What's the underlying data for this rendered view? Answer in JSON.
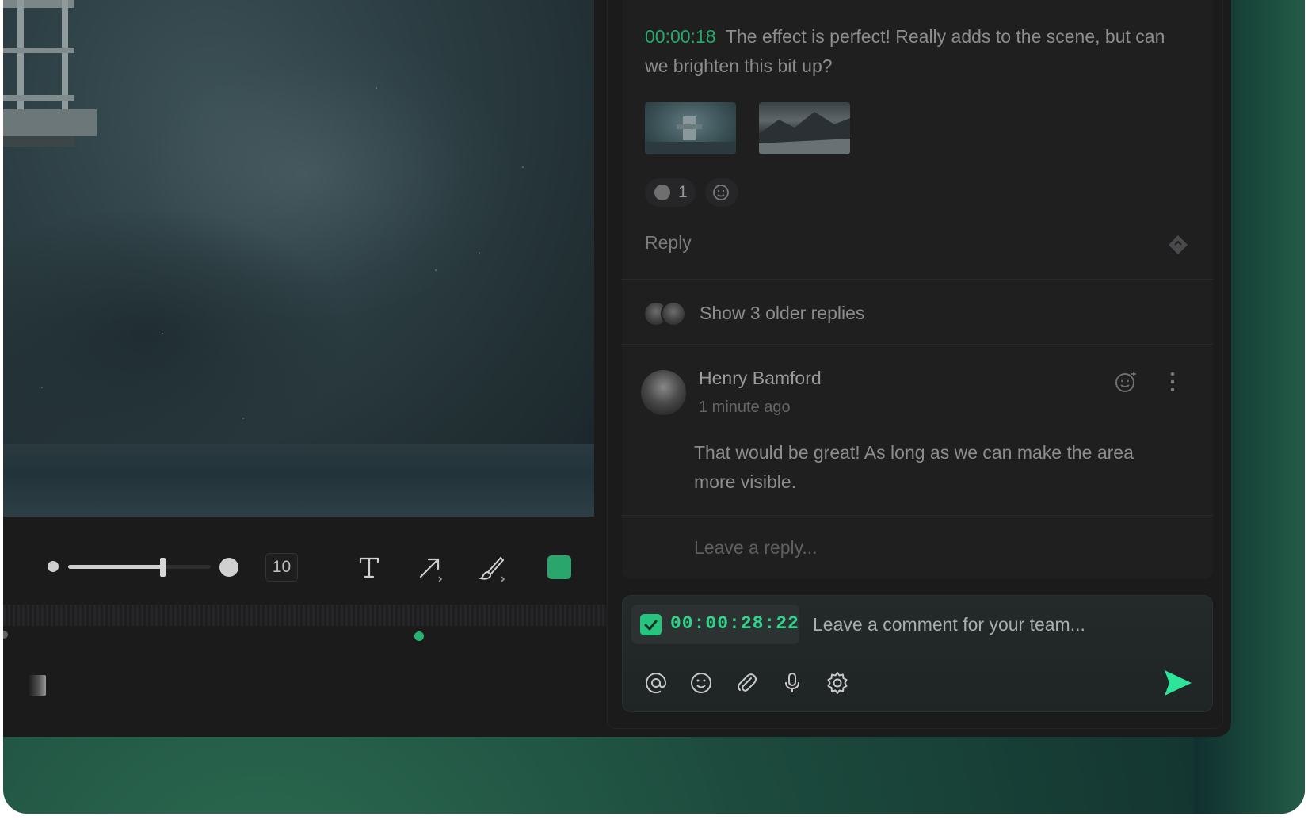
{
  "toolbar": {
    "stroke_size": "10",
    "tools": [
      "text-tool",
      "arrow-tool",
      "brush-tool"
    ],
    "active_color": "#2aa56c"
  },
  "comment": {
    "timestamp": "00:00:18",
    "text": "The effect is perfect! Really adds to the scene, but can we brighten this bit up?",
    "reaction_count": "1",
    "reply_label": "Reply"
  },
  "thread": {
    "older_replies_label": "Show 3 older replies",
    "reply": {
      "author": "Henry Bamford",
      "time_ago": "1 minute ago",
      "text": "That would be great! As long as we can make the area more visible."
    },
    "reply_placeholder": "Leave a reply..."
  },
  "composer": {
    "timestamp": "00:00:28:22",
    "placeholder": "Leave a comment for your team...",
    "icons": [
      "mention-icon",
      "emoji-icon",
      "attach-icon",
      "microphone-icon",
      "settings-icon"
    ]
  },
  "colors": {
    "accent": "#27c47f",
    "timestamp": "#23a96b"
  }
}
